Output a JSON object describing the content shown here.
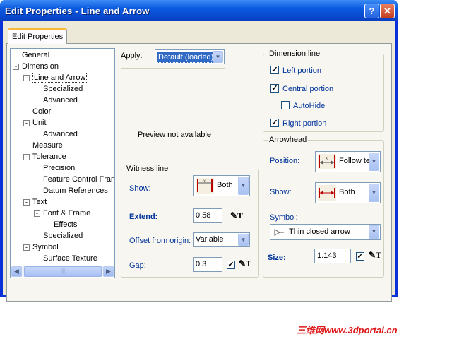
{
  "window": {
    "title": "Edit Properties - Line and Arrow",
    "help_glyph": "?",
    "close_glyph": "✕"
  },
  "tab": {
    "label": "Edit Properties"
  },
  "tree": [
    {
      "label": "General",
      "level": 0,
      "toggle": ""
    },
    {
      "label": "Dimension",
      "level": 0,
      "toggle": "−"
    },
    {
      "label": "Line and Arrow",
      "level": 1,
      "toggle": "−",
      "selected": true
    },
    {
      "label": "Specialized",
      "level": 2,
      "toggle": ""
    },
    {
      "label": "Advanced",
      "level": 2,
      "toggle": ""
    },
    {
      "label": "Color",
      "level": 1,
      "toggle": ""
    },
    {
      "label": "Unit",
      "level": 1,
      "toggle": "−"
    },
    {
      "label": "Advanced",
      "level": 2,
      "toggle": ""
    },
    {
      "label": "Measure",
      "level": 1,
      "toggle": ""
    },
    {
      "label": "Tolerance",
      "level": 1,
      "toggle": "−"
    },
    {
      "label": "Precision",
      "level": 2,
      "toggle": ""
    },
    {
      "label": "Feature Control Fran",
      "level": 2,
      "toggle": ""
    },
    {
      "label": "Datum References",
      "level": 2,
      "toggle": ""
    },
    {
      "label": "Text",
      "level": 1,
      "toggle": "−"
    },
    {
      "label": "Font & Frame",
      "level": 2,
      "toggle": "−"
    },
    {
      "label": "Effects",
      "level": 3,
      "toggle": ""
    },
    {
      "label": "Specialized",
      "level": 2,
      "toggle": ""
    },
    {
      "label": "Symbol",
      "level": 1,
      "toggle": "−"
    },
    {
      "label": "Surface Texture",
      "level": 2,
      "toggle": ""
    }
  ],
  "apply": {
    "label": "Apply:",
    "value": "Default (loaded)"
  },
  "preview": {
    "text": "Preview not available"
  },
  "witness": {
    "title": "Witness line",
    "show_label": "Show:",
    "show_value": "Both",
    "extend_label": "Extend:",
    "extend_value": "0.58",
    "offset_label": "Offset from origin:",
    "offset_value": "Variable",
    "gap_label": "Gap:",
    "gap_value": "0.3",
    "gap_checked": true
  },
  "dimension_line": {
    "title": "Dimension line",
    "options": [
      {
        "label": "Left portion",
        "checked": true
      },
      {
        "label": "Central portion",
        "checked": true
      },
      {
        "label": "AutoHide",
        "checked": false
      },
      {
        "label": "Right portion",
        "checked": true
      }
    ]
  },
  "arrowhead": {
    "title": "Arrowhead",
    "position_label": "Position:",
    "position_value": "Follow te",
    "show_label": "Show:",
    "show_value": "Both",
    "symbol_label": "Symbol:",
    "symbol_value": "Thin closed arrow",
    "size_label": "Size:",
    "size_value": "1.143",
    "size_checked": true
  },
  "watermark": "三维网www.3dportal.cn",
  "colors": {
    "title_bar": "#0a5ae0",
    "label_blue": "#003399",
    "selection": "#316ac5"
  }
}
